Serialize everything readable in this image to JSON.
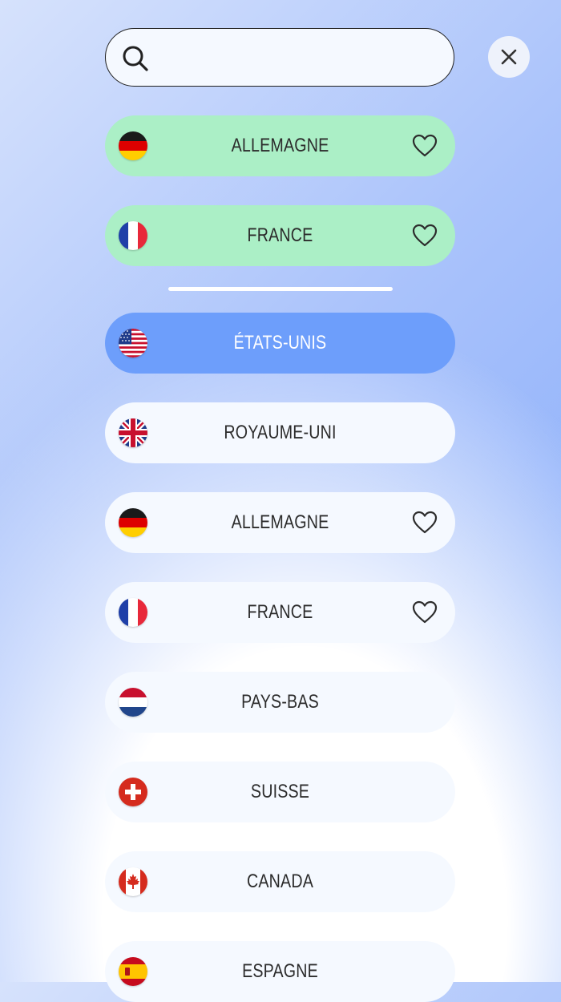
{
  "search": {
    "placeholder": "",
    "value": ""
  },
  "icons": {
    "search": "search-icon",
    "close": "close-icon",
    "favorite": "heart-icon"
  },
  "colors": {
    "favorite_row": "#abefc6",
    "selected_row": "#6d9efb",
    "row": "#f5f9ff"
  },
  "favorites": [
    {
      "label": "ALLEMAGNE",
      "flag": "de",
      "favorite": true
    },
    {
      "label": "FRANCE",
      "flag": "fr",
      "favorite": true
    }
  ],
  "countries": [
    {
      "label": "ÉTATS-UNIS",
      "flag": "us",
      "selected": true
    },
    {
      "label": "ROYAUME-UNI",
      "flag": "gb"
    },
    {
      "label": "ALLEMAGNE",
      "flag": "de",
      "favorite": true
    },
    {
      "label": "FRANCE",
      "flag": "fr",
      "favorite": true
    },
    {
      "label": "PAYS-BAS",
      "flag": "nl"
    },
    {
      "label": "SUISSE",
      "flag": "ch"
    },
    {
      "label": "CANADA",
      "flag": "ca"
    },
    {
      "label": "ESPAGNE",
      "flag": "es"
    }
  ]
}
